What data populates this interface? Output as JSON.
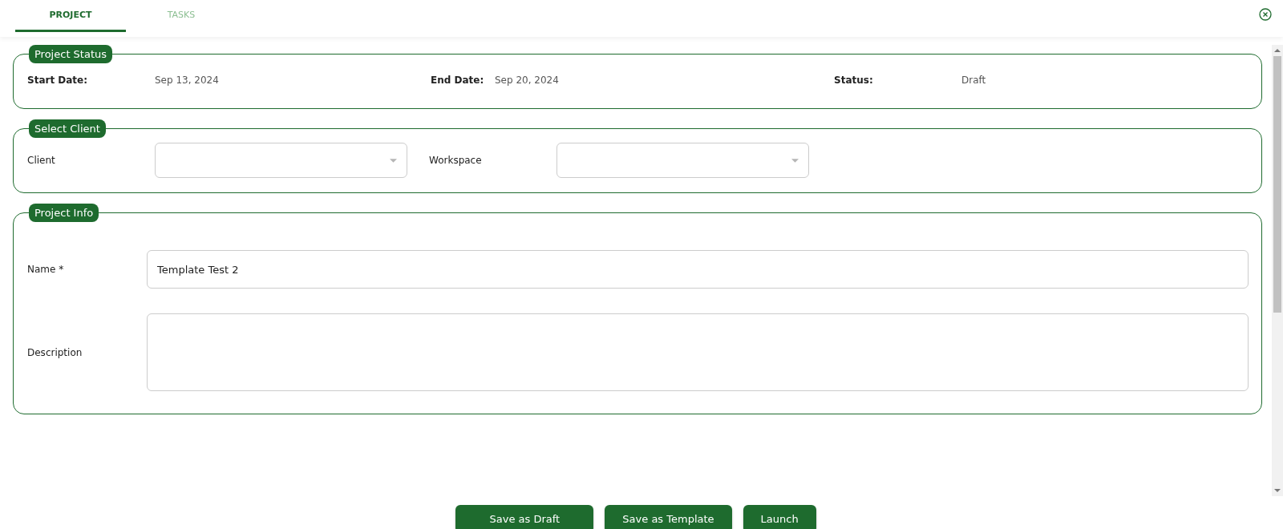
{
  "tabs": [
    {
      "label": "PROJECT",
      "selected": true
    },
    {
      "label": "TASKS",
      "selected": false
    }
  ],
  "sections": [
    {
      "kind": "status",
      "title": "Project Status",
      "fields": [
        {
          "label": "Start Date:",
          "value": "Sep 13, 2024"
        },
        {
          "label": "End Date:",
          "value": "Sep 20, 2024"
        },
        {
          "label": "Status:",
          "value": "Draft"
        }
      ]
    },
    {
      "kind": "select",
      "title": "Select Client",
      "fields": [
        {
          "label": "Client"
        },
        {
          "label": "Workspace"
        }
      ]
    },
    {
      "kind": "form",
      "title": "Project Info",
      "fields": [
        {
          "kind": "input",
          "label": "Name *",
          "value": "Template Test 2"
        },
        {
          "kind": "textarea",
          "label": "Description"
        }
      ]
    }
  ],
  "buttons": [
    "Save as Draft",
    "Save as Template",
    "Launch"
  ]
}
